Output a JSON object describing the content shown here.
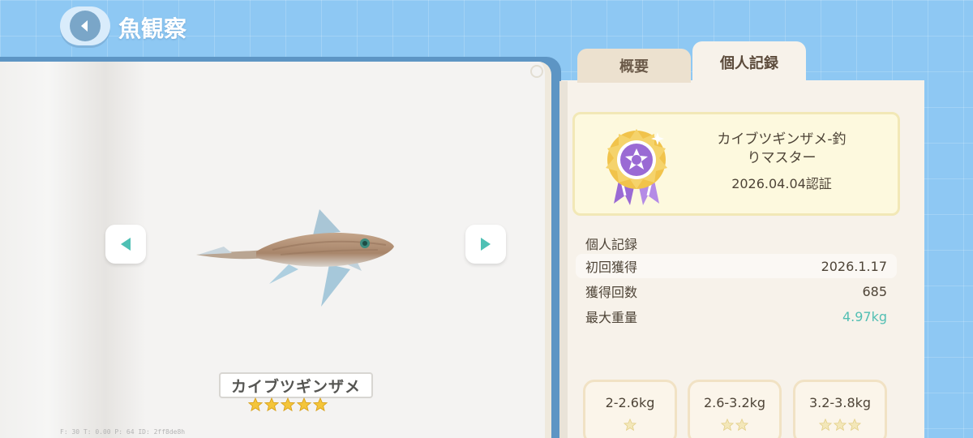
{
  "header": {
    "title": "魚観察",
    "back_icon": "back-arrow-icon"
  },
  "fish": {
    "name": "カイブツギンザメ",
    "stars": 5
  },
  "debug": {
    "text": "F: 30   T: 0.00   P: 64   ID: 2ff8de8h"
  },
  "tabs": [
    {
      "label": "概要",
      "active": false
    },
    {
      "label": "個人記録",
      "active": true
    }
  ],
  "certificate": {
    "title_line1": "カイブツギンザメ-釣",
    "title_line2": "りマスター",
    "date": "2026.04.04認証"
  },
  "records": {
    "heading": "個人記録",
    "rows": [
      {
        "label": "初回獲得",
        "value": "2026.1.17"
      },
      {
        "label": "獲得回数",
        "value": "685"
      },
      {
        "label": "最大重量",
        "value": "4.97kg"
      }
    ]
  },
  "weight_classes": [
    {
      "label": "2-2.6kg",
      "stars": 1
    },
    {
      "label": "2.6-3.2kg",
      "stars": 2
    },
    {
      "label": "3.2-3.8kg",
      "stars": 3
    }
  ],
  "colors": {
    "background": "#8ec8f3",
    "accent_teal": "#52bfb3",
    "star_gold": "#f4c53a",
    "text": "#4e4437"
  }
}
